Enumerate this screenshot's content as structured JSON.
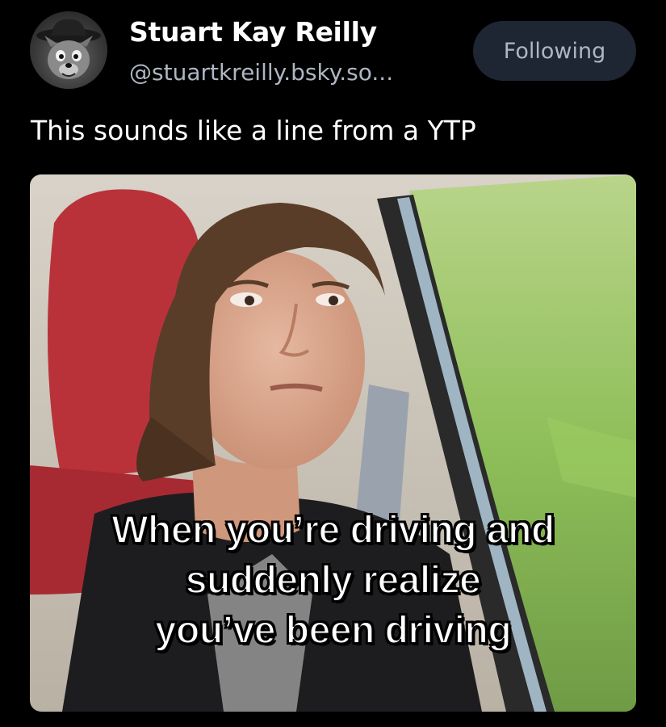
{
  "author": {
    "display_name": "Stuart Kay Reilly",
    "handle": "@stuartkreilly.bsky.so...",
    "avatar_icon": "cartoon-wolf-cowboy-avatar"
  },
  "follow_button": {
    "label": "Following"
  },
  "post": {
    "text": "This sounds like a line from a YTP"
  },
  "media": {
    "caption_lines": [
      "When you’re driving and",
      "suddenly realize",
      "you’ve been driving"
    ]
  },
  "colors": {
    "background": "#000000",
    "handle_text": "#aeb6c2",
    "button_bg": "#1e2633"
  }
}
